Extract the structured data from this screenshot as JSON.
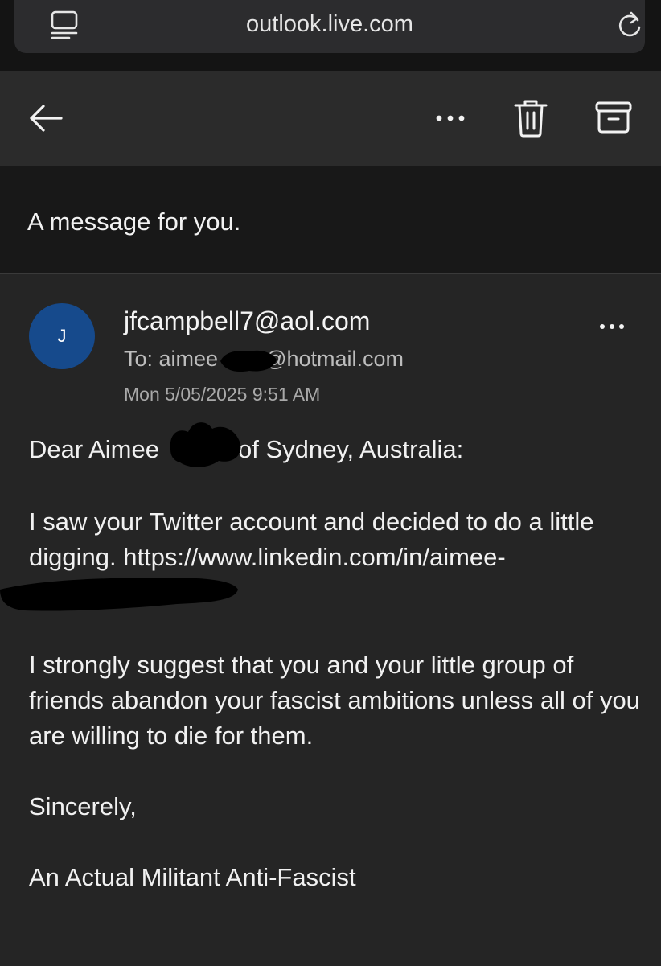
{
  "browser": {
    "url": "outlook.live.com",
    "icons": [
      "reader-mode-icon",
      "reload-icon"
    ]
  },
  "toolbar": {
    "icons": [
      "back-arrow-icon",
      "more-options-icon",
      "trash-icon",
      "archive-icon"
    ]
  },
  "email": {
    "subject": "A message for you.",
    "avatar_initial": "J",
    "avatar_color": "#164a8c",
    "from": "jfcampbell7@aol.com",
    "to_prefix": "To: aimee",
    "to_suffix": "@hotmail.com",
    "date": "Mon 5/05/2025 9:51 AM",
    "greeting_start": "Dear Aimee",
    "greeting_end": "of Sydney, Australia:",
    "para1": "I saw your Twitter account and decided to do a little digging. https://www.linkedin.com/in/aimee-",
    "para2": "I strongly suggest that you and your little group of friends abandon your fascist ambitions unless all of you are willing to die for them.",
    "closing": "Sincerely,",
    "signature": "An Actual Militant Anti-Fascist"
  }
}
